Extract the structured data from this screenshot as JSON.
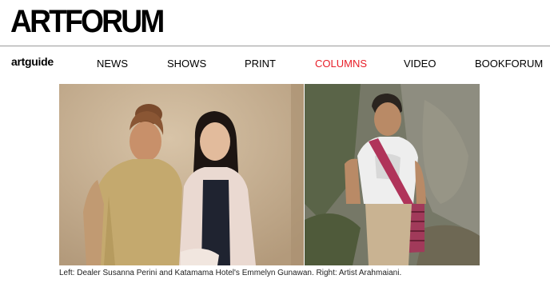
{
  "header": {
    "logo_text": "ARTFORUM"
  },
  "nav": {
    "brand": "artguide",
    "items": [
      {
        "label": "NEWS"
      },
      {
        "label": "SHOWS"
      },
      {
        "label": "PRINT"
      },
      {
        "label": "COLUMNS",
        "active": true
      },
      {
        "label": "VIDEO"
      },
      {
        "label": "BOOKFORUM"
      }
    ]
  },
  "colors": {
    "active_nav": "#e8202a",
    "divider": "#9a9a9a"
  },
  "photos": {
    "left_description_icon": "photo-of-two-women",
    "right_description_icon": "photo-of-artist-outdoors"
  },
  "caption": "Left: Dealer Susanna Perini and Katamama Hotel's Emmelyn Gunawan. Right: Artist Arahmaiani."
}
